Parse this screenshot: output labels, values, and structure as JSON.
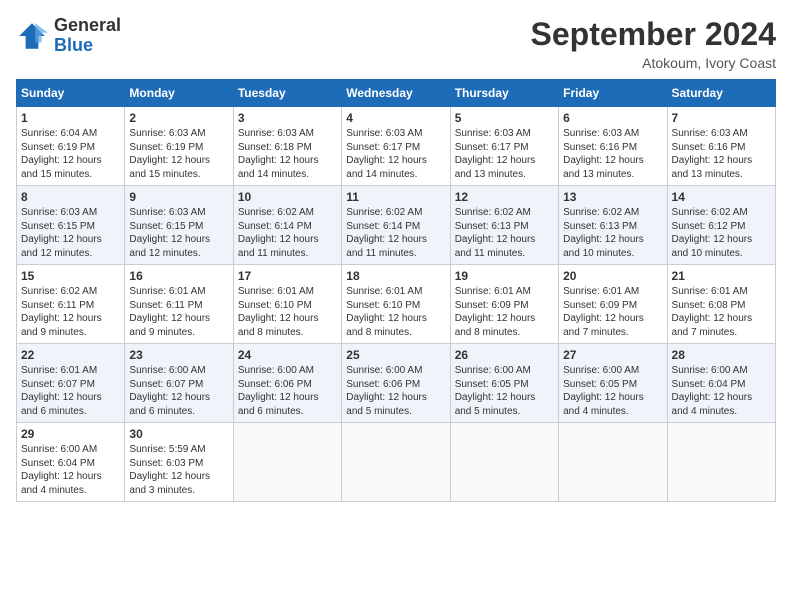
{
  "logo": {
    "general": "General",
    "blue": "Blue"
  },
  "header": {
    "month": "September 2024",
    "location": "Atokoum, Ivory Coast"
  },
  "weekdays": [
    "Sunday",
    "Monday",
    "Tuesday",
    "Wednesday",
    "Thursday",
    "Friday",
    "Saturday"
  ],
  "weeks": [
    [
      {
        "day": "1",
        "info": "Sunrise: 6:04 AM\nSunset: 6:19 PM\nDaylight: 12 hours\nand 15 minutes."
      },
      {
        "day": "2",
        "info": "Sunrise: 6:03 AM\nSunset: 6:19 PM\nDaylight: 12 hours\nand 15 minutes."
      },
      {
        "day": "3",
        "info": "Sunrise: 6:03 AM\nSunset: 6:18 PM\nDaylight: 12 hours\nand 14 minutes."
      },
      {
        "day": "4",
        "info": "Sunrise: 6:03 AM\nSunset: 6:17 PM\nDaylight: 12 hours\nand 14 minutes."
      },
      {
        "day": "5",
        "info": "Sunrise: 6:03 AM\nSunset: 6:17 PM\nDaylight: 12 hours\nand 13 minutes."
      },
      {
        "day": "6",
        "info": "Sunrise: 6:03 AM\nSunset: 6:16 PM\nDaylight: 12 hours\nand 13 minutes."
      },
      {
        "day": "7",
        "info": "Sunrise: 6:03 AM\nSunset: 6:16 PM\nDaylight: 12 hours\nand 13 minutes."
      }
    ],
    [
      {
        "day": "8",
        "info": "Sunrise: 6:03 AM\nSunset: 6:15 PM\nDaylight: 12 hours\nand 12 minutes."
      },
      {
        "day": "9",
        "info": "Sunrise: 6:03 AM\nSunset: 6:15 PM\nDaylight: 12 hours\nand 12 minutes."
      },
      {
        "day": "10",
        "info": "Sunrise: 6:02 AM\nSunset: 6:14 PM\nDaylight: 12 hours\nand 11 minutes."
      },
      {
        "day": "11",
        "info": "Sunrise: 6:02 AM\nSunset: 6:14 PM\nDaylight: 12 hours\nand 11 minutes."
      },
      {
        "day": "12",
        "info": "Sunrise: 6:02 AM\nSunset: 6:13 PM\nDaylight: 12 hours\nand 11 minutes."
      },
      {
        "day": "13",
        "info": "Sunrise: 6:02 AM\nSunset: 6:13 PM\nDaylight: 12 hours\nand 10 minutes."
      },
      {
        "day": "14",
        "info": "Sunrise: 6:02 AM\nSunset: 6:12 PM\nDaylight: 12 hours\nand 10 minutes."
      }
    ],
    [
      {
        "day": "15",
        "info": "Sunrise: 6:02 AM\nSunset: 6:11 PM\nDaylight: 12 hours\nand 9 minutes."
      },
      {
        "day": "16",
        "info": "Sunrise: 6:01 AM\nSunset: 6:11 PM\nDaylight: 12 hours\nand 9 minutes."
      },
      {
        "day": "17",
        "info": "Sunrise: 6:01 AM\nSunset: 6:10 PM\nDaylight: 12 hours\nand 8 minutes."
      },
      {
        "day": "18",
        "info": "Sunrise: 6:01 AM\nSunset: 6:10 PM\nDaylight: 12 hours\nand 8 minutes."
      },
      {
        "day": "19",
        "info": "Sunrise: 6:01 AM\nSunset: 6:09 PM\nDaylight: 12 hours\nand 8 minutes."
      },
      {
        "day": "20",
        "info": "Sunrise: 6:01 AM\nSunset: 6:09 PM\nDaylight: 12 hours\nand 7 minutes."
      },
      {
        "day": "21",
        "info": "Sunrise: 6:01 AM\nSunset: 6:08 PM\nDaylight: 12 hours\nand 7 minutes."
      }
    ],
    [
      {
        "day": "22",
        "info": "Sunrise: 6:01 AM\nSunset: 6:07 PM\nDaylight: 12 hours\nand 6 minutes."
      },
      {
        "day": "23",
        "info": "Sunrise: 6:00 AM\nSunset: 6:07 PM\nDaylight: 12 hours\nand 6 minutes."
      },
      {
        "day": "24",
        "info": "Sunrise: 6:00 AM\nSunset: 6:06 PM\nDaylight: 12 hours\nand 6 minutes."
      },
      {
        "day": "25",
        "info": "Sunrise: 6:00 AM\nSunset: 6:06 PM\nDaylight: 12 hours\nand 5 minutes."
      },
      {
        "day": "26",
        "info": "Sunrise: 6:00 AM\nSunset: 6:05 PM\nDaylight: 12 hours\nand 5 minutes."
      },
      {
        "day": "27",
        "info": "Sunrise: 6:00 AM\nSunset: 6:05 PM\nDaylight: 12 hours\nand 4 minutes."
      },
      {
        "day": "28",
        "info": "Sunrise: 6:00 AM\nSunset: 6:04 PM\nDaylight: 12 hours\nand 4 minutes."
      }
    ],
    [
      {
        "day": "29",
        "info": "Sunrise: 6:00 AM\nSunset: 6:04 PM\nDaylight: 12 hours\nand 4 minutes."
      },
      {
        "day": "30",
        "info": "Sunrise: 5:59 AM\nSunset: 6:03 PM\nDaylight: 12 hours\nand 3 minutes."
      },
      {
        "day": "",
        "info": ""
      },
      {
        "day": "",
        "info": ""
      },
      {
        "day": "",
        "info": ""
      },
      {
        "day": "",
        "info": ""
      },
      {
        "day": "",
        "info": ""
      }
    ]
  ]
}
